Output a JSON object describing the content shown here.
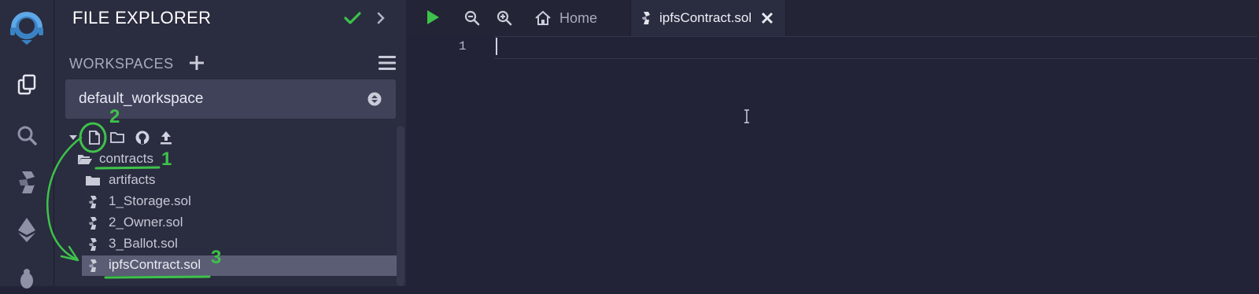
{
  "colors": {
    "accent_green": "#3ec24a",
    "rail_logo_blue": "#3a82c4",
    "panel_bg": "#2a2c3f",
    "selected_row": "#5b5d75"
  },
  "rail": {
    "icons": [
      "remix-logo-icon",
      "file-explorer-icon",
      "search-icon",
      "solidity-compiler-icon",
      "deploy-run-icon",
      "debugger-icon"
    ]
  },
  "explorer": {
    "title": "FILE EXPLORER",
    "workspaces_label": "WORKSPACES",
    "workspace_selected": "default_workspace",
    "tree": [
      {
        "label": "contracts",
        "kind": "folder-open"
      },
      {
        "label": "artifacts",
        "kind": "folder"
      },
      {
        "label": "1_Storage.sol",
        "kind": "sol-file"
      },
      {
        "label": "2_Owner.sol",
        "kind": "sol-file"
      },
      {
        "label": "3_Ballot.sol",
        "kind": "sol-file"
      },
      {
        "label": "ipfsContract.sol",
        "kind": "sol-file",
        "selected": true
      }
    ]
  },
  "editor": {
    "tabs": [
      {
        "label": "Home"
      },
      {
        "label": "ipfsContract.sol",
        "active": true
      }
    ],
    "line_numbers": [
      "1"
    ]
  },
  "annotations": {
    "step1": "1",
    "step2": "2",
    "step3": "3"
  }
}
